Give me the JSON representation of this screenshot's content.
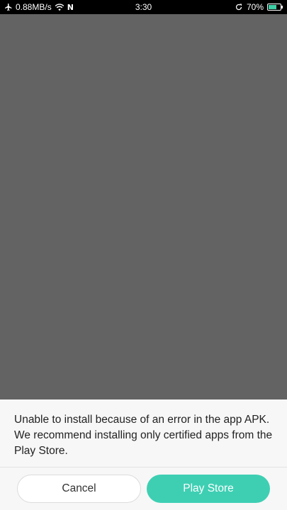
{
  "status_bar": {
    "network_speed": "0.88MB/s",
    "n_label": "N",
    "time": "3:30",
    "battery_percent": "70%",
    "battery_level": 0.7,
    "icons": [
      "airplane-icon",
      "wifi-icon",
      "sync-icon",
      "battery-icon"
    ]
  },
  "dialog": {
    "message": "Unable to install because of an error in the app APK. We recommend installing only certified apps from the Play Store.",
    "cancel_label": "Cancel",
    "play_store_label": "Play Store"
  },
  "colors": {
    "overlay": "#636363",
    "status_bar": "#000000",
    "dialog_background": "#f7f7f7",
    "accent": "#3ecfb3"
  }
}
